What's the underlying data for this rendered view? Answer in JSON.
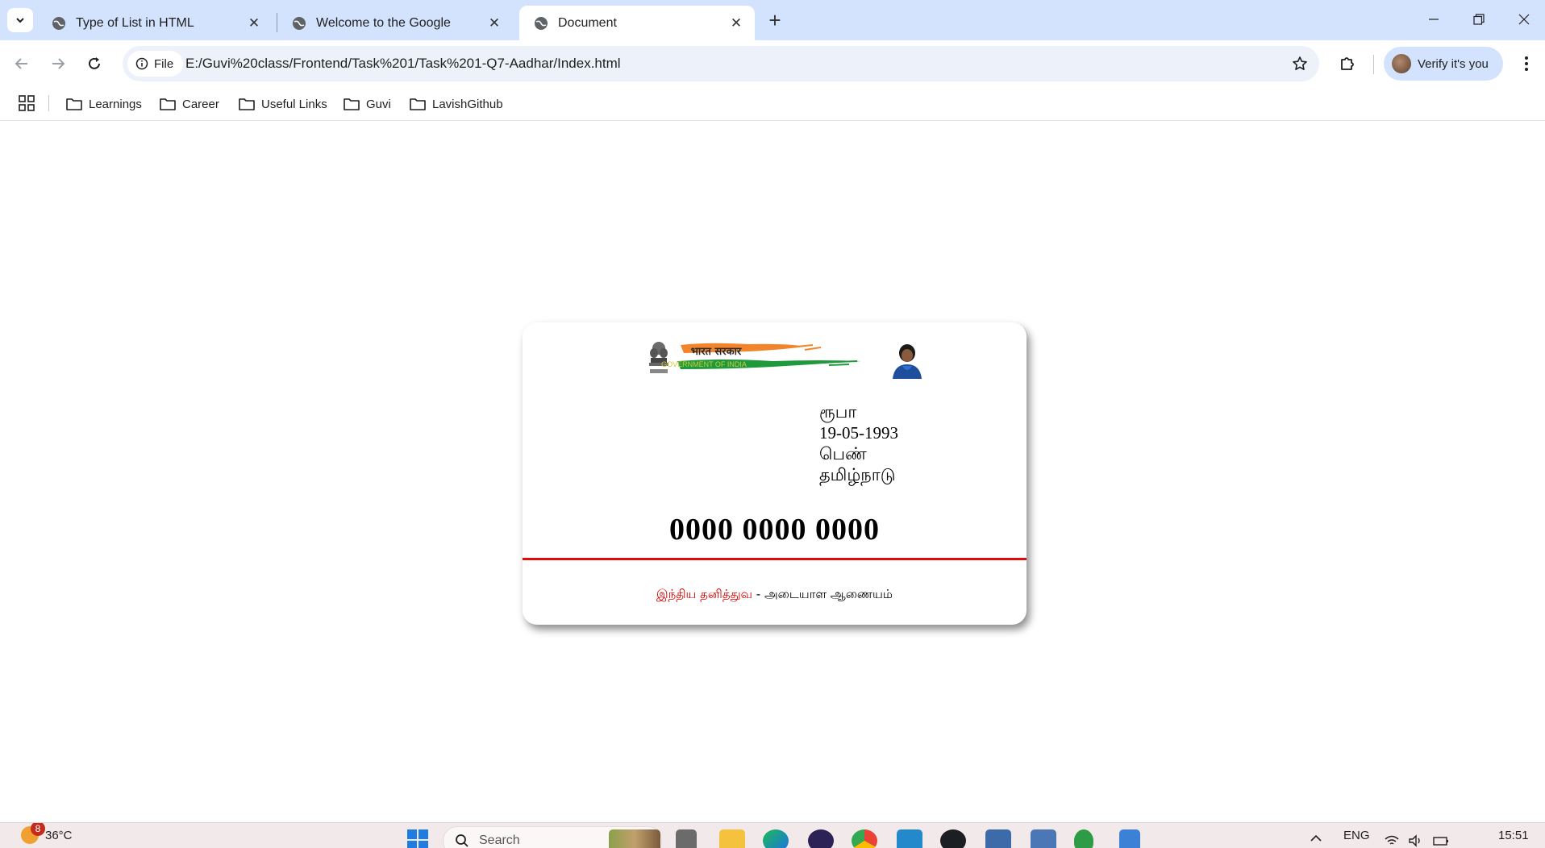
{
  "browser": {
    "tabs": [
      {
        "title": "Type of List in HTML",
        "active": false
      },
      {
        "title": "Welcome to the Google",
        "active": false
      },
      {
        "title": "Document",
        "active": true
      }
    ],
    "new_tab_label": "+",
    "address_bar": {
      "scheme_chip": "File",
      "url": "E:/Guvi%20class/Frontend/Task%201/Task%201-Q7-Aadhar/Index.html"
    },
    "profile_label": "Verify it's you",
    "bookmarks": [
      "Learnings",
      "Career",
      "Useful Links",
      "Guvi",
      "LavishGithub"
    ]
  },
  "card": {
    "header_hindi": "भारत सरकार",
    "header_english": "GOVERNMENT OF INDIA",
    "name": "ரூபா",
    "dob": "19-05-1993",
    "gender": "பெண்",
    "state": "தமிழ்நாடு",
    "aadhaar_number": "0000 0000 0000",
    "footer_red": "இந்திய தனித்துவ",
    "footer_separator": " - ",
    "footer_black": "அடையாள ஆணையம்",
    "colors": {
      "accent_line": "#e20a0a",
      "footer_red": "#d40000"
    }
  },
  "taskbar": {
    "weather_temp": "36°C",
    "notification_count": "8",
    "search_placeholder": "Search",
    "language": "ENG",
    "clock": "15:51"
  }
}
